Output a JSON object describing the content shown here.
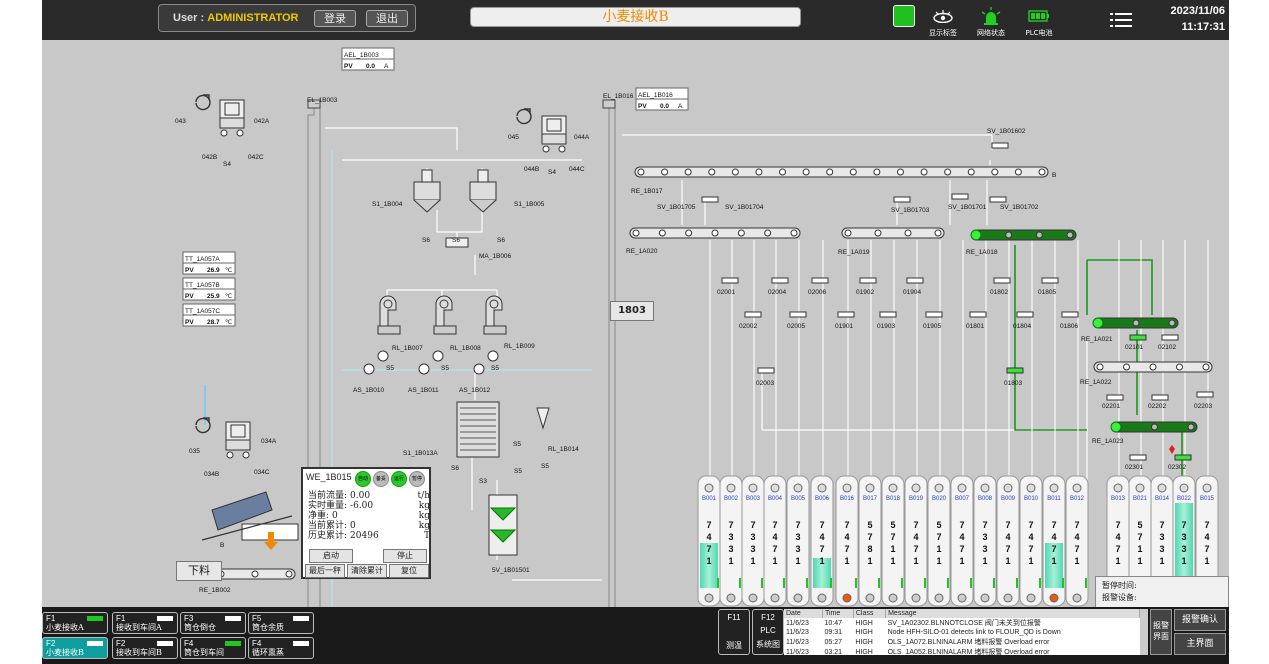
{
  "header": {
    "user_label": "User :",
    "user_name": "ADMINISTRATOR",
    "login": "登录",
    "logout": "退出",
    "title": "小麦接收B",
    "status": [
      {
        "label": "显示标签"
      },
      {
        "label": "网络状态"
      },
      {
        "label": "PLC电池"
      }
    ],
    "date": "2023/11/06",
    "time": "11:17:31"
  },
  "tags": {
    "left": [
      "043",
      "042A",
      "042B",
      "S4",
      "042C",
      "035",
      "034A",
      "034B",
      "034C",
      "RE_1B002",
      "EL_1B003",
      "S6",
      "S6",
      "S6"
    ],
    "mid": [
      "S1_1B004",
      "S1_1B005",
      "MA_1B006",
      "RL_1B007",
      "RL_1B008",
      "RL_1B009",
      "AS_1B010",
      "AS_1B011",
      "AS_1B012",
      "S5",
      "S5",
      "S5",
      "S1_1B013A",
      "S3",
      "S5",
      "S5",
      "S6",
      "RL_1B014",
      "S5",
      "5V_1B01501",
      "045",
      "044A",
      "044B",
      "S4",
      "044C",
      "EL_1B016"
    ],
    "right": [
      "SV_1B01602",
      "RE_1B017",
      "SV_1B01705",
      "SV_1B01704",
      "SV_1B01703",
      "SV_1B01701",
      "SV_1B01702",
      "RE_1A020",
      "RE_1A019",
      "RE_1A018",
      "RE_1A021",
      "RE_1A022",
      "RE_1A023",
      "B",
      "B"
    ],
    "valves": [
      "02001",
      "02004",
      "02006",
      "01902",
      "01904",
      "01802",
      "01805",
      "02002",
      "02005",
      "01901",
      "01903",
      "01905",
      "01801",
      "01804",
      "01806",
      "02003",
      "01803",
      "02101",
      "02102",
      "02201",
      "02202",
      "02203",
      "02301",
      "02302"
    ]
  },
  "analog": [
    {
      "tag": "AEL_1B003",
      "pv": "0.0",
      "unit": "A"
    },
    {
      "tag": "AEL_1B016",
      "pv": "0.0",
      "unit": "A"
    },
    {
      "tag": "TT_1A057A",
      "pv": "26.9",
      "unit": "℃"
    },
    {
      "tag": "TT_1A057B",
      "pv": "25.9",
      "unit": "℃"
    },
    {
      "tag": "TT_1A057C",
      "pv": "28.7",
      "unit": "℃"
    }
  ],
  "pv_label": "PV",
  "silos": [
    {
      "id": "B001",
      "val": "7471",
      "fill": 0.45
    },
    {
      "id": "B002",
      "val": "7331",
      "fill": 0
    },
    {
      "id": "B003",
      "val": "7331",
      "fill": 0
    },
    {
      "id": "B004",
      "val": "7471",
      "fill": 0
    },
    {
      "id": "B005",
      "val": "7331",
      "fill": 0
    },
    {
      "id": "B006",
      "val": "7471",
      "fill": 0.3
    },
    {
      "id": "B016",
      "val": "7471",
      "fill": 0
    },
    {
      "id": "B017",
      "val": "5781",
      "fill": 0
    },
    {
      "id": "B018",
      "val": "5711",
      "fill": 0
    },
    {
      "id": "B019",
      "val": "7471",
      "fill": 0
    },
    {
      "id": "B020",
      "val": "5711",
      "fill": 0
    },
    {
      "id": "B007",
      "val": "7471",
      "fill": 0
    },
    {
      "id": "B008",
      "val": "7331",
      "fill": 0
    },
    {
      "id": "B009",
      "val": "7471",
      "fill": 0
    },
    {
      "id": "B010",
      "val": "7471",
      "fill": 0
    },
    {
      "id": "B011",
      "val": "7471",
      "fill": 0.45
    },
    {
      "id": "B012",
      "val": "7471",
      "fill": 0
    },
    {
      "id": "B013",
      "val": "7471",
      "fill": 0
    },
    {
      "id": "B021",
      "val": "5711",
      "fill": 0
    },
    {
      "id": "B014",
      "val": "7331",
      "fill": 0
    },
    {
      "id": "B022",
      "val": "7331",
      "fill": 0.85
    },
    {
      "id": "B015",
      "val": "7471",
      "fill": 0
    }
  ],
  "label_1803": "1803",
  "xialiao": "下料",
  "weigher": {
    "tag": "WE_1B015",
    "modes": [
      "自动",
      "备妥",
      "运行",
      "暂停"
    ],
    "rows": [
      {
        "k": "当前流量:",
        "v": "0.00",
        "u": "t/h"
      },
      {
        "k": "实时重量:",
        "v": "-6.00",
        "u": "kg"
      },
      {
        "k": "净重:",
        "v": "0",
        "u": "kg"
      },
      {
        "k": "当前累计:",
        "v": "0",
        "u": "kg"
      },
      {
        "k": "历史累计:",
        "v": "20496",
        "u": "T"
      }
    ],
    "btn_start": "启动",
    "btn_stop": "停止",
    "btn_last": "最后一秤",
    "btn_clear": "清除累计",
    "btn_reset": "复位"
  },
  "pause": {
    "line1": "暂停时间:",
    "line2": "报警设备:"
  },
  "fkeys": [
    {
      "n": "F1",
      "t": "小麦接收A"
    },
    {
      "n": "F1",
      "t": "接收到车间A"
    },
    {
      "n": "F3",
      "t": "筒仓倒仓"
    },
    {
      "n": "F5",
      "t": "筒仓余质"
    },
    {
      "n": "F2",
      "t": "小麦接收B"
    },
    {
      "n": "F2",
      "t": "接收到车间B"
    },
    {
      "n": "F4",
      "t": "筒仓到车间"
    },
    {
      "n": "F4",
      "t": "循环熏蒸"
    }
  ],
  "fk2": [
    {
      "n": "F11",
      "t": "测温"
    },
    {
      "n": "F12",
      "t": "PLC",
      "t2": "系统图"
    }
  ],
  "alarm": {
    "cols": [
      "Date",
      "Time",
      "Class",
      "Message"
    ],
    "rows": [
      [
        "11/6/23",
        "10:47",
        "HIGH",
        "SV_1A02302.BLNNOTCLOSE 阀门未关到位报警"
      ],
      [
        "11/6/23",
        "09:31",
        "HIGH",
        "Node HFH-SILO-01 detects link to FLOUR_QD is Down"
      ],
      [
        "11/6/23",
        "05:27",
        "HIGH",
        "OLS_1A072.BLNINALARM 堵料报警 Overload error"
      ],
      [
        "11/6/23",
        "03:21",
        "HIGH",
        "OLS_1A052.BLNINALARM 堵料报警 Overload error"
      ]
    ]
  },
  "abtns": {
    "a1": "报警界面",
    "a2": "报警确认",
    "a3": "主界面"
  }
}
